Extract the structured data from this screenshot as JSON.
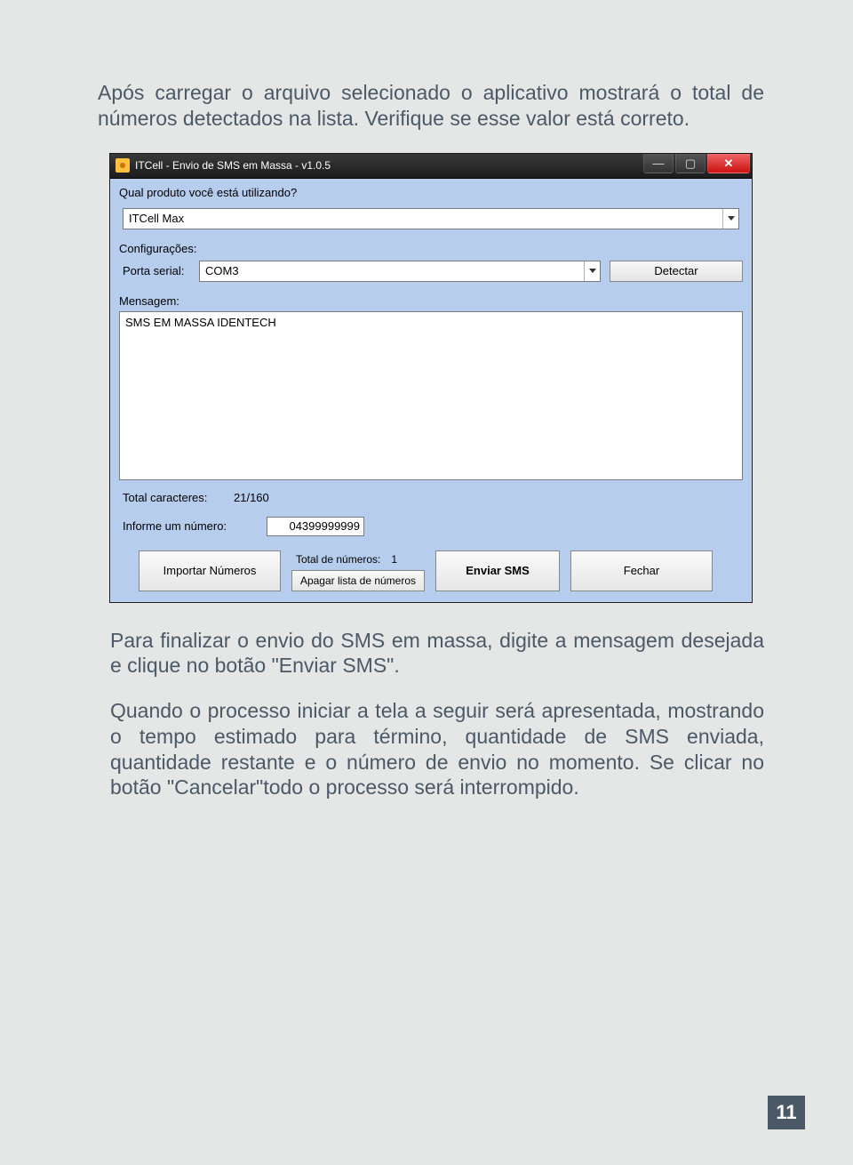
{
  "intro": "Após carregar o arquivo selecionado o aplicativo mostrará o total de números detectados na lista. Verifique se esse valor está correto.",
  "window": {
    "title": "ITCell - Envio de SMS em Massa - v1.0.5",
    "question": "Qual produto você está utilizando?",
    "product_value": "ITCell Max",
    "config_label": "Configurações:",
    "serial_label": "Porta serial:",
    "serial_value": "COM3",
    "detect_btn": "Detectar",
    "msg_label": "Mensagem:",
    "msg_value": "SMS EM MASSA IDENTECH",
    "chars_label": "Total caracteres:",
    "chars_value": "21/160",
    "numero_label": "Informe um número:",
    "numero_value": "04399999999",
    "import_btn": "Importar Números",
    "total_label": "Total de números:",
    "total_value": "1",
    "clear_btn": "Apagar lista de números",
    "send_btn": "Enviar SMS",
    "close_btn": "Fechar"
  },
  "para1": "Para finalizar o envio do SMS em massa, digite  a mensagem desejada e clique no botão \"Enviar SMS\".",
  "para2": "Quando o processo iniciar a tela a seguir será apresentada, mostrando o tempo estimado para término, quantidade de SMS enviada, quantidade restante e o número de envio no momento. Se clicar no botão \"Cancelar\"todo o processo será interrompido.",
  "page_number": "11"
}
